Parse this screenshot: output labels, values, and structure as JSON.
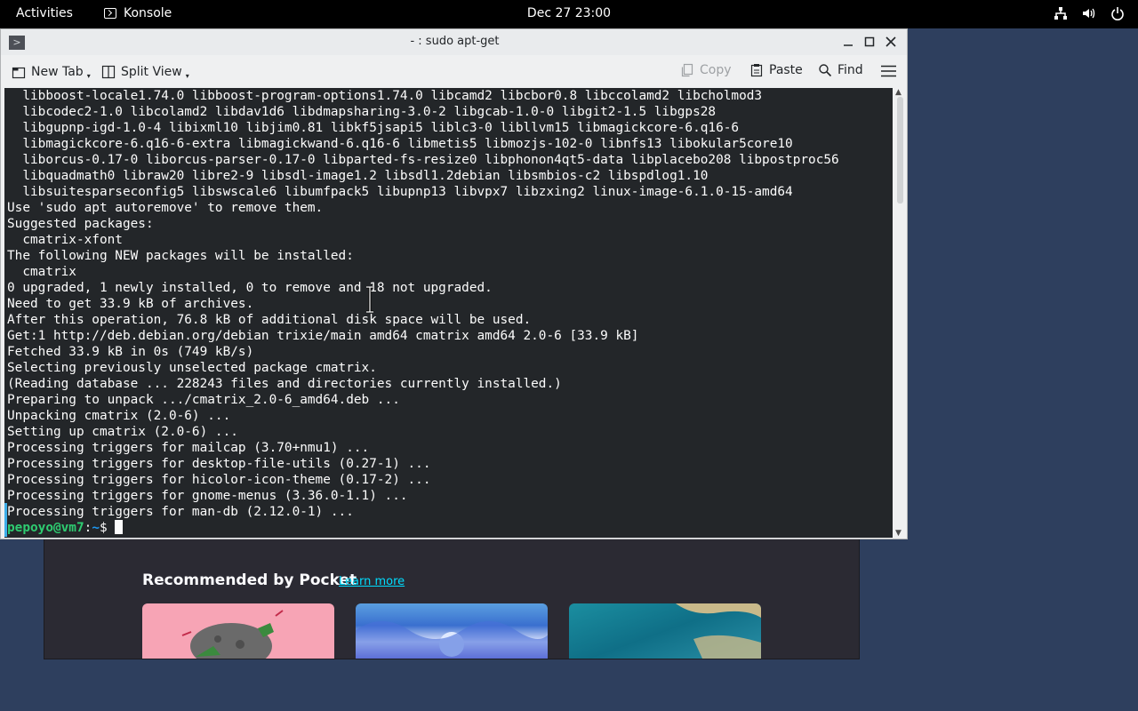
{
  "topbar": {
    "activities": "Activities",
    "app_name": "Konsole",
    "clock": "Dec 27  23:00",
    "icons": [
      "network-icon",
      "volume-icon",
      "power-icon"
    ]
  },
  "browser": {
    "pocket_title": "Recommended by Pocket",
    "pocket_link": "Learn more"
  },
  "konsole": {
    "title": "- : sudo apt-get",
    "toolbar": {
      "new_tab": "New Tab",
      "split_view": "Split View",
      "copy": "Copy",
      "paste": "Paste",
      "find": "Find"
    },
    "terminal": {
      "lines": [
        "  libboost-locale1.74.0 libboost-program-options1.74.0 libcamd2 libcbor0.8 libccolamd2 libcholmod3",
        "  libcodec2-1.0 libcolamd2 libdav1d6 libdmapsharing-3.0-2 libgcab-1.0-0 libgit2-1.5 libgps28",
        "  libgupnp-igd-1.0-4 libixml10 libjim0.81 libkf5jsapi5 liblc3-0 libllvm15 libmagickcore-6.q16-6",
        "  libmagickcore-6.q16-6-extra libmagickwand-6.q16-6 libmetis5 libmozjs-102-0 libnfs13 libokular5core10",
        "  liborcus-0.17-0 liborcus-parser-0.17-0 libparted-fs-resize0 libphonon4qt5-data libplacebo208 libpostproc56",
        "  libquadmath0 libraw20 libre2-9 libsdl-image1.2 libsdl1.2debian libsmbios-c2 libspdlog1.10",
        "  libsuitesparseconfig5 libswscale6 libumfpack5 libupnp13 libvpx7 libzxing2 linux-image-6.1.0-15-amd64",
        "Use 'sudo apt autoremove' to remove them.",
        "Suggested packages:",
        "  cmatrix-xfont",
        "The following NEW packages will be installed:",
        "  cmatrix",
        "0 upgraded, 1 newly installed, 0 to remove and 18 not upgraded.",
        "Need to get 33.9 kB of archives.",
        "After this operation, 76.8 kB of additional disk space will be used.",
        "Get:1 http://deb.debian.org/debian trixie/main amd64 cmatrix amd64 2.0-6 [33.9 kB]",
        "Fetched 33.9 kB in 0s (749 kB/s)",
        "Selecting previously unselected package cmatrix.",
        "(Reading database ... 228243 files and directories currently installed.)",
        "Preparing to unpack .../cmatrix_2.0-6_amd64.deb ...",
        "Unpacking cmatrix (2.0-6) ...",
        "Setting up cmatrix (2.0-6) ...",
        "Processing triggers for mailcap (3.70+nmu1) ...",
        "Processing triggers for desktop-file-utils (0.27-1) ...",
        "Processing triggers for hicolor-icon-theme (0.17-2) ...",
        "Processing triggers for gnome-menus (3.36.0-1.1) ...",
        "Processing triggers for man-db (2.12.0-1) ..."
      ],
      "prompt_user": "pepoyo@vm7",
      "prompt_sep": ":",
      "prompt_path": "~",
      "prompt_symbol": "$ "
    }
  }
}
